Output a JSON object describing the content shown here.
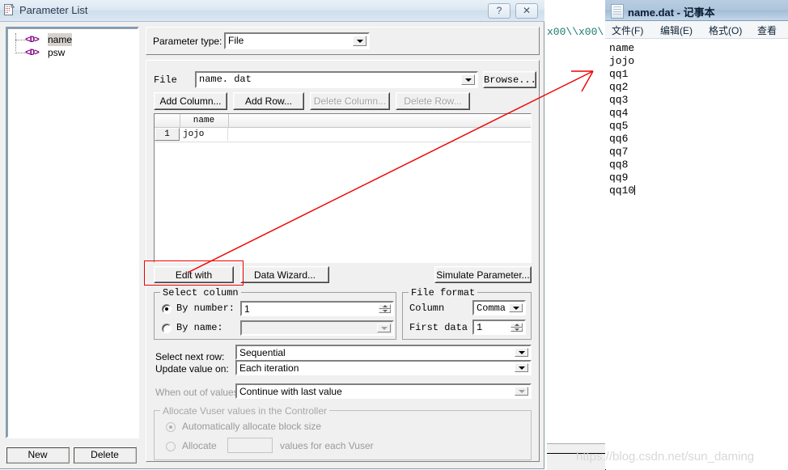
{
  "background": {
    "code_text": "x00\\\\x00\\"
  },
  "dialog": {
    "title": "Parameter List",
    "icon": "document-icon",
    "help_button": "?",
    "close_button": "✕",
    "tree": {
      "items": [
        {
          "label": "name",
          "icon": "parameter-icon",
          "selected": true
        },
        {
          "label": "psw",
          "icon": "parameter-icon",
          "selected": false
        }
      ]
    },
    "footer": {
      "new_label": "New",
      "delete_label": "Delete"
    },
    "parameter_type": {
      "label": "Parameter type:",
      "value": "File"
    },
    "file_row": {
      "label": "File",
      "value": "name. dat",
      "browse_label": "Browse..."
    },
    "grid_buttons": {
      "add_column": "Add Column...",
      "add_row": "Add Row...",
      "delete_column": "Delete Column...",
      "delete_row": "Delete Row..."
    },
    "grid": {
      "columns": [
        "name"
      ],
      "rows": [
        {
          "num": "1",
          "cells": [
            "jojo"
          ]
        }
      ]
    },
    "action_buttons": {
      "edit_with_notepad": "Edit with Notepad...",
      "data_wizard": "Data Wizard...",
      "simulate_parameter": "Simulate Parameter..."
    },
    "select_column": {
      "caption": "Select column",
      "by_number_label": "By number:",
      "by_number_selected": true,
      "by_number_value": "1",
      "by_name_label": "By name:",
      "by_name_selected": false,
      "by_name_value": ""
    },
    "file_format": {
      "caption": "File format",
      "column_label": "Column",
      "column_value": "Comma",
      "first_data_label": "First data",
      "first_data_value": "1"
    },
    "rows_section": {
      "select_next_row_label": "Select next row:",
      "select_next_row_value": "Sequential",
      "update_value_on_label": "Update value on:",
      "update_value_on_value": "Each iteration",
      "when_out_of_values_label": "When out of values:",
      "when_out_of_values_value": "Continue with last value"
    },
    "allocate": {
      "caption": "Allocate Vuser values in the Controller",
      "auto_label": "Automatically allocate block size",
      "auto_selected": true,
      "manual_prefix": "Allocate",
      "manual_value": "",
      "manual_suffix": "values for each Vuser",
      "manual_selected": false
    }
  },
  "notepad": {
    "title": "name.dat - 记事本",
    "icon": "notepad-icon",
    "menu": [
      "文件(F)",
      "编辑(E)",
      "格式(O)",
      "查看(V)"
    ],
    "lines": [
      "name",
      "jojo",
      "qq1",
      "qq2",
      "qq3",
      "qq4",
      "qq5",
      "qq6",
      "qq7",
      "qq8",
      "qq9",
      "qq10"
    ]
  },
  "annotation": {
    "highlight_target": "edit-with-notepad-button",
    "arrow_color": "#ef0000"
  },
  "watermark": "https://blog.csdn.net/sun_daming"
}
